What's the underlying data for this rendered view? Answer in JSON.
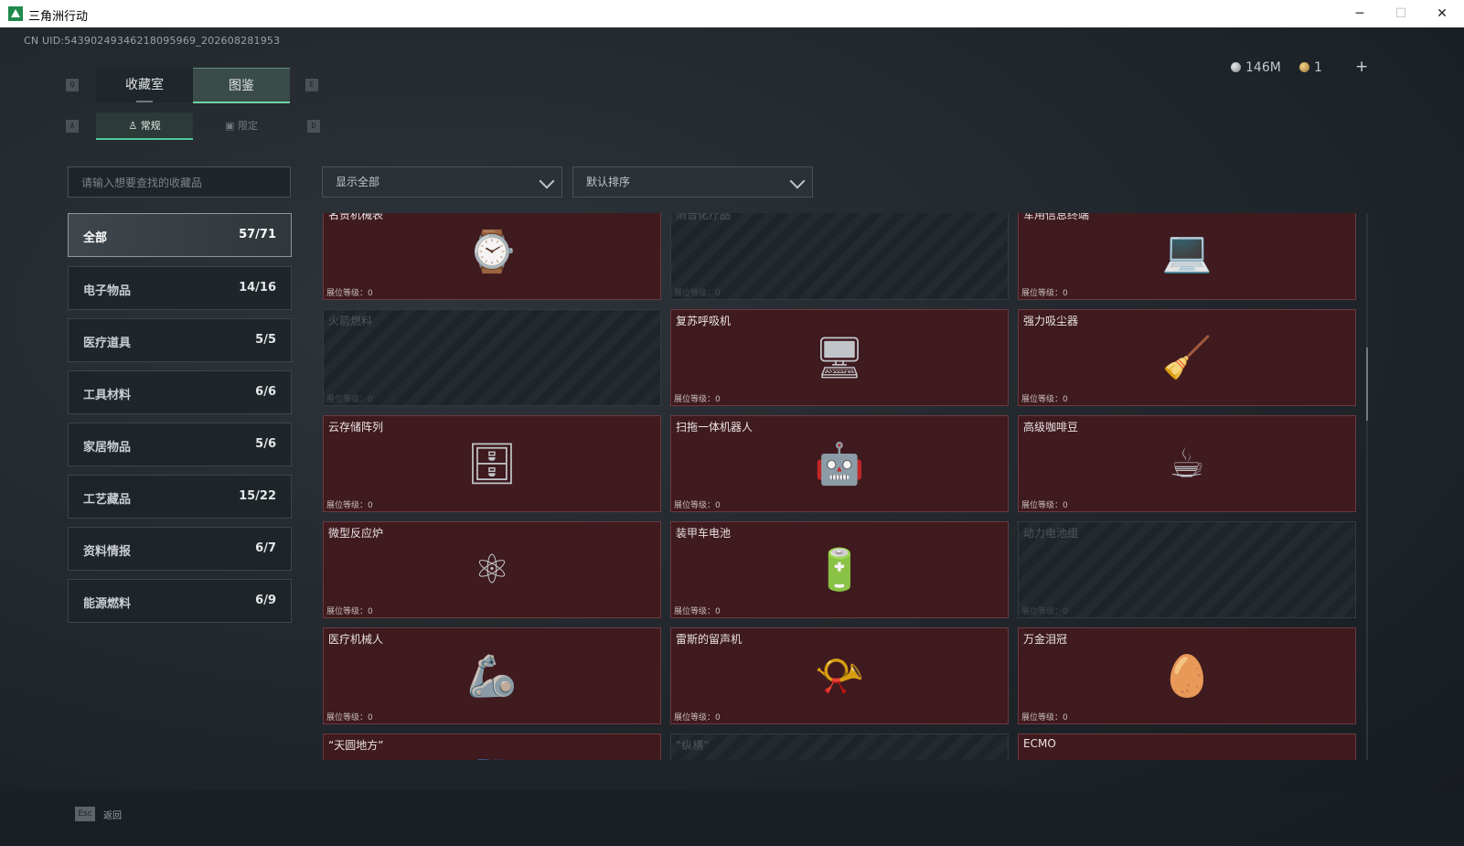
{
  "window": {
    "title": "三角洲行动",
    "controls": [
      "─",
      "☐",
      "✕"
    ]
  },
  "uid": "CN UID:54390249346218095969_202608281953",
  "currency": [
    {
      "icon": "silver-coin-icon",
      "value": "146M"
    },
    {
      "icon": "gold-coin-icon",
      "value": "1"
    }
  ],
  "plus_label": "+",
  "key_hints": {
    "tab_prev": "Q",
    "tab_next": "E",
    "sub_prev": "A",
    "sub_next": "D"
  },
  "tabs": [
    {
      "label": "收藏室",
      "active": false
    },
    {
      "label": "图鉴",
      "active": true
    }
  ],
  "subtabs": [
    {
      "label": "常规",
      "icon": "figure-icon",
      "active": true
    },
    {
      "label": "限定",
      "icon": "picture-icon",
      "active": false
    }
  ],
  "search": {
    "placeholder": "请输入想要查找的收藏品"
  },
  "filter": {
    "value": "显示全部"
  },
  "sort": {
    "value": "默认排序"
  },
  "categories": [
    {
      "label": "全部",
      "count": "57/71",
      "active": true
    },
    {
      "label": "电子物品",
      "count": "14/16"
    },
    {
      "label": "医疗道具",
      "count": "5/5"
    },
    {
      "label": "工具材料",
      "count": "6/6"
    },
    {
      "label": "家居物品",
      "count": "5/6"
    },
    {
      "label": "工艺藏品",
      "count": "15/22"
    },
    {
      "label": "资料情报",
      "count": "6/7"
    },
    {
      "label": "能源燃料",
      "count": "6/9"
    }
  ],
  "level_label": "展位等级：",
  "level_value": "0",
  "items": [
    {
      "name": "名贵机械表",
      "owned": true,
      "icon": "watch-icon"
    },
    {
      "name": "消音化疗品",
      "owned": false,
      "icon": "rifle-icon"
    },
    {
      "name": "军用信息终端",
      "owned": true,
      "icon": "laptop-case-icon"
    },
    {
      "name": "火箭燃料",
      "owned": false,
      "icon": "fuel-canister-icon"
    },
    {
      "name": "复苏呼吸机",
      "owned": true,
      "icon": "ventilator-icon"
    },
    {
      "name": "强力吸尘器",
      "owned": true,
      "icon": "vacuum-icon"
    },
    {
      "name": "云存储阵列",
      "owned": true,
      "icon": "server-array-icon"
    },
    {
      "name": "扫拖一体机器人",
      "owned": true,
      "icon": "robot-vacuum-icon"
    },
    {
      "name": "高级咖啡豆",
      "owned": true,
      "icon": "coffee-bag-icon"
    },
    {
      "name": "微型反应炉",
      "owned": true,
      "icon": "reactor-icon"
    },
    {
      "name": "装甲车电池",
      "owned": true,
      "icon": "battery-icon"
    },
    {
      "name": "动力电池组",
      "owned": false,
      "icon": "battery-pack-icon"
    },
    {
      "name": "医疗机械人",
      "owned": true,
      "icon": "medical-robot-icon"
    },
    {
      "name": "雷斯的留声机",
      "owned": true,
      "icon": "gramophone-icon"
    },
    {
      "name": "万金泪冠",
      "owned": true,
      "icon": "jewel-egg-icon"
    },
    {
      "name": "“天圆地方”",
      "owned": true,
      "icon": "golden-disc-icon"
    },
    {
      "name": "“纵横”",
      "owned": false,
      "icon": "artifact-icon"
    },
    {
      "name": "ECMO",
      "owned": true,
      "icon": "ecmo-icon"
    }
  ],
  "footer": {
    "esc_key": "Esc",
    "back_label": "返回"
  }
}
